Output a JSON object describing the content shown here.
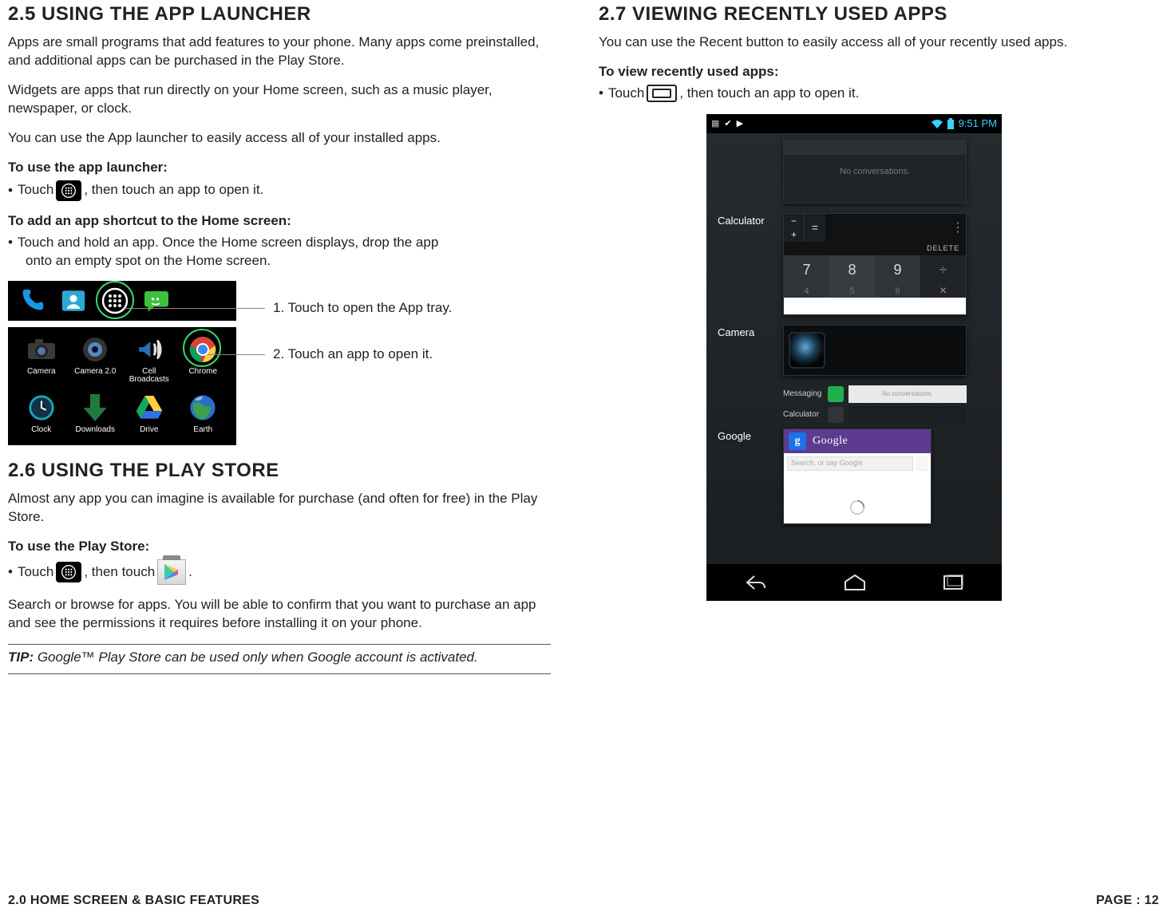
{
  "left": {
    "s25": {
      "heading": "2.5 USING THE APP LAUNCHER",
      "p1": "Apps are small programs that add features to your phone. Many apps come preinstalled, and additional apps can be purchased in the Play Store.",
      "p2": "Widgets are apps that run directly on your Home screen, such as a music player, newspaper, or clock.",
      "p3": "You can use the App launcher to easily access all of your installed apps.",
      "use_label": "To use the app launcher:",
      "use_bullet_pre": "Touch",
      "use_bullet_post": ", then touch an app to open it.",
      "add_label": "To add an app shortcut to the Home screen:",
      "add_bullet": "Touch and hold an app. Once the Home screen displays, drop the app",
      "add_bullet_cont": "onto an empty spot on the Home screen.",
      "callout1": "1. Touch to open the App tray.",
      "callout2": "2. Touch an app to open it.",
      "grid": [
        "Camera",
        "Camera 2.0",
        "Cell Broadcasts",
        "Chrome",
        "Clock",
        "Downloads",
        "Drive",
        "Earth"
      ]
    },
    "s26": {
      "heading": "2.6 USING THE PLAY STORE",
      "p1": "Almost any app you can imagine is available for purchase (and often for free) in the Play Store.",
      "use_label": "To use the Play Store:",
      "b_pre": "Touch",
      "b_mid": ", then touch",
      "b_post": ".",
      "p2": "Search or browse for apps. You will be able to confirm that you want to purchase an app and see the permissions it requires before installing it on your phone.",
      "tip_label": "TIP:",
      "tip_text": " Google™ Play Store can be used only when Google account is activated."
    }
  },
  "right": {
    "s27": {
      "heading": "2.7 VIEWING RECENTLY USED APPS",
      "p1": "You can use the Recent button to easily access all of your recently used apps.",
      "use_label": "To view recently used apps:",
      "b_pre": "Touch",
      "b_post": ", then touch an app to open it."
    },
    "phone": {
      "time": "9:51 PM",
      "msg_label": "",
      "msg_text": "No conversations.",
      "calc_label": "Calculator",
      "calc_delete": "DELETE",
      "calc_keys_r1": [
        "7",
        "8",
        "9",
        "÷"
      ],
      "calc_keys_r2": [
        "4",
        "5",
        "6",
        "×"
      ],
      "cam_label": "Camera",
      "mini_msg": "Messaging",
      "mini_msg_txt": "No conversations.",
      "mini_calc": "Calculator",
      "goog_label": "Google",
      "goog_logo": "Google",
      "goog_search_ph": "Search, or say Google"
    }
  },
  "footer": {
    "left": "2.0 HOME SCREEN & BASIC FEATURES",
    "right": "PAGE : 12"
  }
}
